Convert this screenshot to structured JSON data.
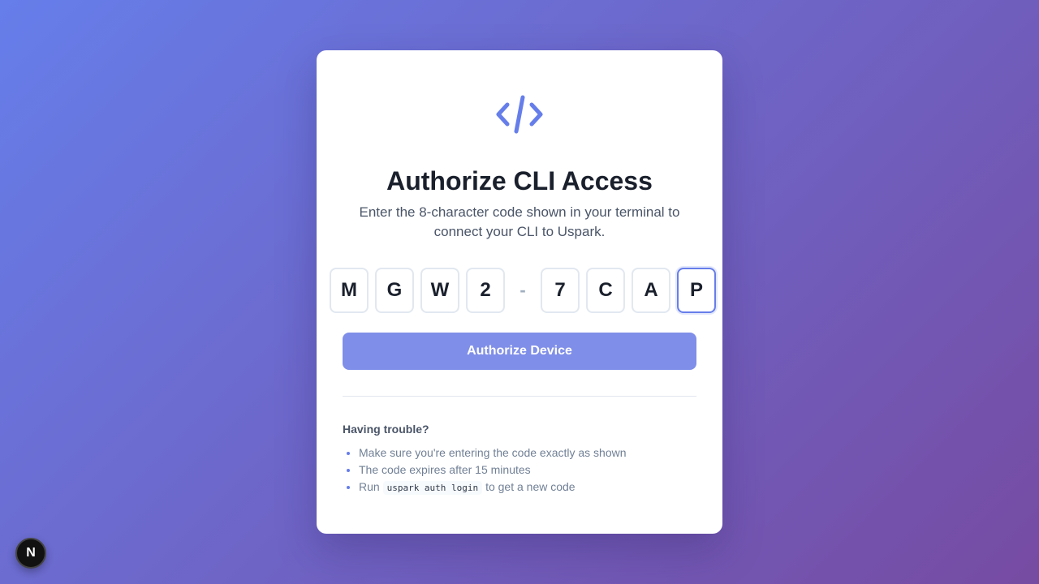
{
  "colors": {
    "accent": "#667eea",
    "button": "#7f8ee8",
    "title": "#1a202c"
  },
  "card": {
    "logo_icon": "code-icon",
    "title": "Authorize CLI Access",
    "subtitle": "Enter the 8-character code shown in your terminal to connect your CLI to Uspark.",
    "code": [
      "M",
      "G",
      "W",
      "2",
      "7",
      "C",
      "A",
      "P"
    ],
    "separator": "-",
    "authorize_label": "Authorize Device",
    "help": {
      "title": "Having trouble?",
      "items": [
        "Make sure you're entering the code exactly as shown",
        "The code expires after 15 minutes"
      ],
      "run_prefix": "Run",
      "run_command": "uspark auth login",
      "run_suffix": "to get a new code"
    }
  },
  "badge": {
    "letter": "N"
  }
}
